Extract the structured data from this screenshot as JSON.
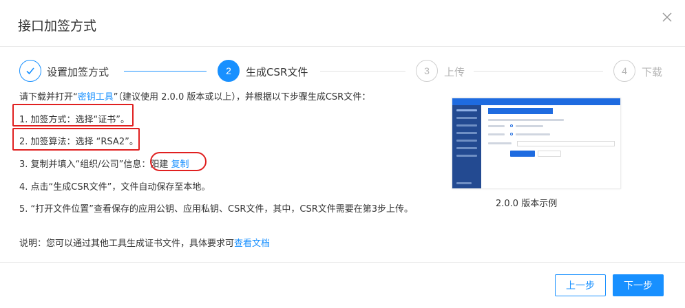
{
  "dialog": {
    "title": "接口加签方式",
    "close_icon": "close-icon"
  },
  "steps": [
    {
      "number": "1",
      "label": "设置加签方式",
      "status": "done",
      "icon": "check-icon"
    },
    {
      "number": "2",
      "label": "生成CSR文件",
      "status": "active"
    },
    {
      "number": "3",
      "label": "上传",
      "status": "wait"
    },
    {
      "number": "4",
      "label": "下载",
      "status": "wait"
    }
  ],
  "content": {
    "intro_prefix": "请下载并打开“",
    "intro_link": "密钥工具",
    "intro_suffix": "”（建议使用 2.0.0 版本或以上），并根据以下步骤生成CSR文件：",
    "item1": "1. 加签方式：选择“证书”。",
    "item2": "2. 加签算法：选择 “RSA2”。",
    "item3_prefix": "3. 复制并填入“组织/公司”信息：",
    "item3_value": "阳建",
    "item3_copy": "复制",
    "item4": "4. 点击“生成CSR文件”，文件自动保存至本地。",
    "item5": "5. “打开文件位置”查看保存的应用公钥、应用私钥、CSR文件，其中，CSR文件需要在第3步上传。",
    "note_prefix": "说明：您可以通过其他工具生成证书文件，具体要求可",
    "note_link": "查看文档"
  },
  "preview": {
    "caption": "2.0.0 版本示例"
  },
  "footer": {
    "prev_label": "上一步",
    "next_label": "下一步"
  },
  "colors": {
    "accent": "#1890ff",
    "annotation_red": "#e02020"
  }
}
